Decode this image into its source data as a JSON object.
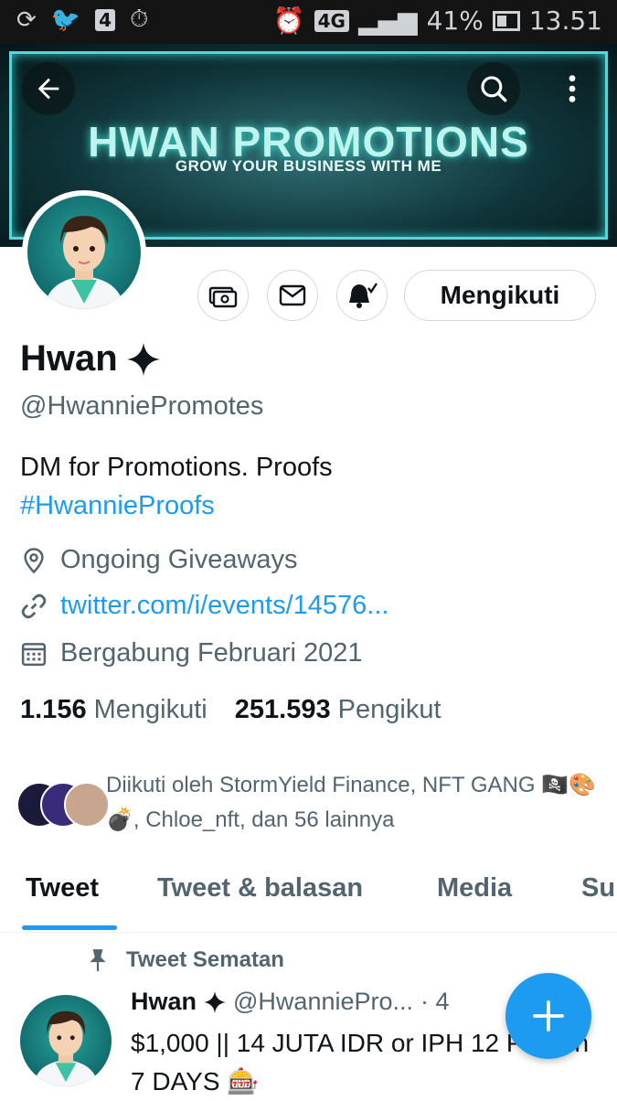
{
  "status_bar": {
    "network": "4G",
    "sim_badge": "4",
    "battery": "41%",
    "time": "13.51"
  },
  "banner": {
    "title": "HWAN PROMOTIONS",
    "subtitle": "GROW YOUR BUSINESS WITH ME"
  },
  "profile": {
    "name": "Hwan",
    "handle": "@HwanniePromotes",
    "bio": "DM for Promotions. Proofs",
    "bio_hashtag": "#HwannieProofs",
    "location": "Ongoing Giveaways",
    "link": "twitter.com/i/events/14576...",
    "joined": "Bergabung Februari 2021",
    "following_count": "1.156",
    "following_label": "Mengikuti",
    "followers_count": "251.593",
    "followers_label": "Pengikut",
    "follow_button": "Mengikuti",
    "followed_by": "Diikuti oleh StormYield Finance, NFT GANG 🏴‍☠️🎨💣, Chloe_nft, dan 56 lainnya"
  },
  "tabs": [
    "Tweet",
    "Tweet & balasan",
    "Media",
    "Su"
  ],
  "tweet": {
    "pinned_label": "Tweet Sematan",
    "author": "Hwan",
    "handle": "@HwanniePro...",
    "time": "· 4",
    "text": "$1,000 || 14 JUTA IDR or IPH 12 PRO in 7 DAYS 🎰"
  },
  "colors": {
    "accent": "#1d9bf0",
    "banner_glow": "#5ad4d4",
    "text_secondary": "#536471"
  },
  "icons": [
    "back-arrow-icon",
    "search-icon",
    "more-vertical-icon",
    "tip-jar-icon",
    "mail-icon",
    "bell-icon",
    "verified-sparkle-icon",
    "location-icon",
    "link-icon",
    "calendar-icon",
    "pin-icon",
    "compose-plus-icon"
  ]
}
